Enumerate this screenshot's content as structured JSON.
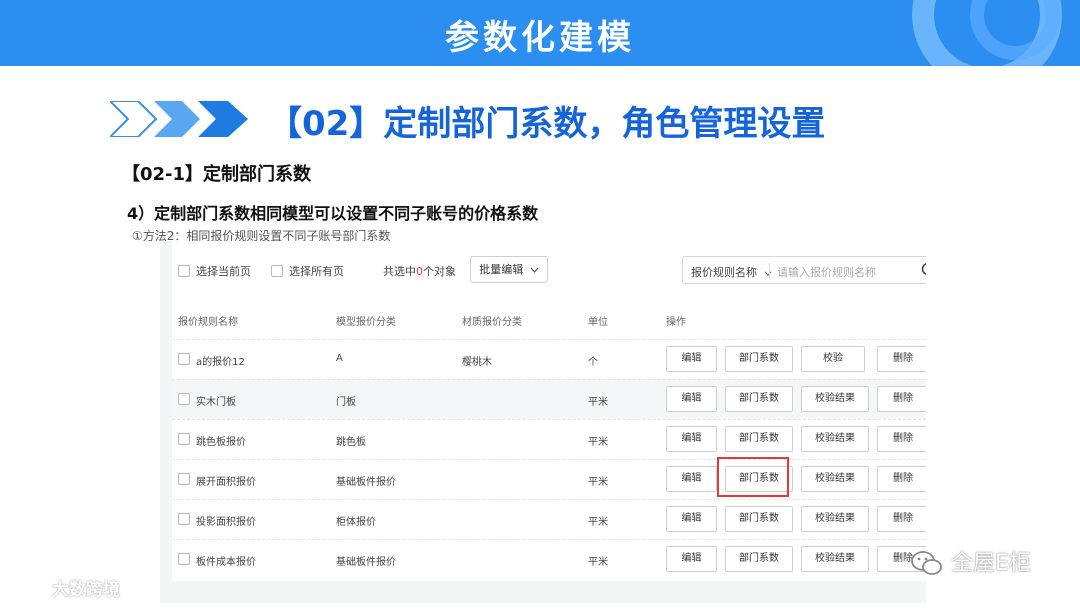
{
  "banner": {
    "title": "参数化建模"
  },
  "section": {
    "title": "【02】定制部门系数，角色管理设置"
  },
  "subsection": {
    "title": "【02-1】定制部门系数"
  },
  "point": {
    "title": "4）定制部门系数相同模型可以设置不同子账号的价格系数"
  },
  "method_note": "①方法2：相同报价规则设置不同子账号部门系数",
  "toolbar": {
    "select_page": "选择当前页",
    "select_all": "选择所有页",
    "selected_prefix": "共选中",
    "selected_count": "0",
    "selected_suffix": "个对象",
    "batch_edit": "批量编辑",
    "search_field": "报价规则名称",
    "search_placeholder": "请输入报价规则名称"
  },
  "table": {
    "headers": [
      "报价规则名称",
      "模型报价分类",
      "材质报价分类",
      "单位",
      "操作"
    ],
    "rows": [
      {
        "name": "a的报价12",
        "model_cat": "A",
        "material_cat": "樱桃木",
        "unit": "个",
        "actions": [
          "编辑",
          "部门系数",
          "校验",
          "删除"
        ]
      },
      {
        "name": "实木门板",
        "model_cat": "门板",
        "material_cat": "",
        "unit": "平米",
        "actions": [
          "编辑",
          "部门系数",
          "校验结果",
          "删除"
        ]
      },
      {
        "name": "跳色板报价",
        "model_cat": "跳色板",
        "material_cat": "",
        "unit": "平米",
        "actions": [
          "编辑",
          "部门系数",
          "校验结果",
          "删除"
        ]
      },
      {
        "name": "展开面积报价",
        "model_cat": "基础板件报价",
        "material_cat": "",
        "unit": "平米",
        "actions": [
          "编辑",
          "部门系数",
          "校验结果",
          "删除"
        ]
      },
      {
        "name": "投影面积报价",
        "model_cat": "柜体报价",
        "material_cat": "",
        "unit": "平米",
        "actions": [
          "编辑",
          "部门系数",
          "校验结果",
          "删除"
        ]
      },
      {
        "name": "板件成本报价",
        "model_cat": "基础板件报价",
        "material_cat": "",
        "unit": "平米",
        "actions": [
          "编辑",
          "部门系数",
          "校验结果",
          "删除"
        ]
      }
    ]
  },
  "watermarks": {
    "left": "大数跨境",
    "right": "全屋E柜"
  },
  "colors": {
    "banner": "#2b8ef0",
    "section_title": "#1565d8",
    "highlight": "#e03a3a",
    "count": "#e23b3b"
  }
}
